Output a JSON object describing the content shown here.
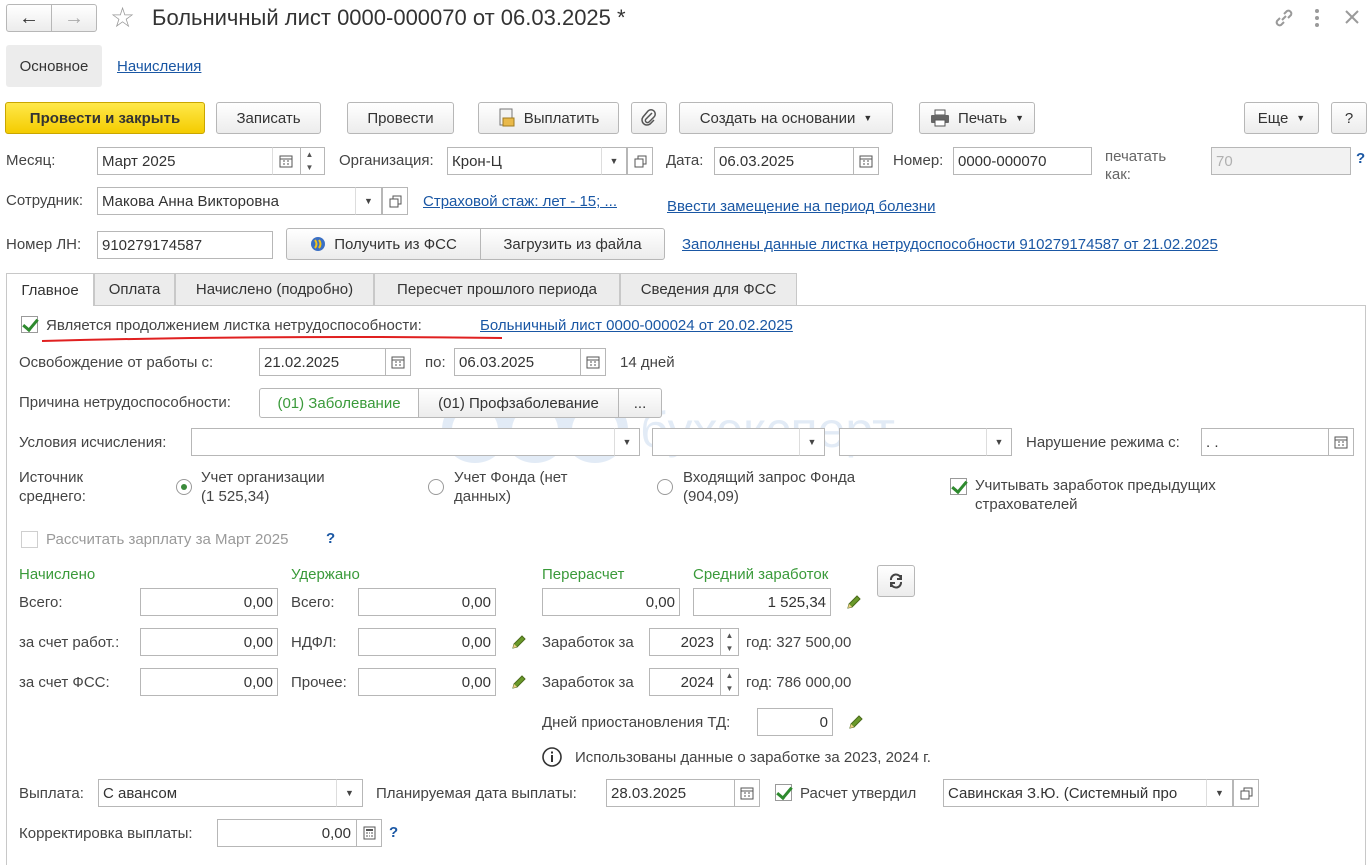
{
  "window": {
    "title": "Больничный лист 0000-000070 от 06.03.2025 *"
  },
  "nav": {
    "back": "←",
    "forward": "→",
    "star": "☆"
  },
  "sections": {
    "main": "Основное",
    "accruals": "Начисления"
  },
  "toolbar": {
    "post_close": "Провести и закрыть",
    "save": "Записать",
    "post": "Провести",
    "pay": "Выплатить",
    "create_based": "Создать на основании",
    "print": "Печать",
    "more": "Еще",
    "help": "?"
  },
  "header": {
    "month_label": "Месяц:",
    "month_value": "Март 2025",
    "org_label": "Организация:",
    "org_value": "Крон-Ц",
    "date_label": "Дата:",
    "date_value": "06.03.2025",
    "number_label": "Номер:",
    "number_value": "0000-000070",
    "print_as_label_1": "печатать",
    "print_as_label_2": "как:",
    "print_as_value": "70",
    "employee_label": "Сотрудник:",
    "employee_value": "Макова Анна Викторовна",
    "insurance_link": "Страховой стаж: лет - 15; ...",
    "replace_link": "Ввести замещение на период болезни",
    "ln_label": "Номер ЛН:",
    "ln_value": "910279174587",
    "get_fss": "Получить из ФСС",
    "load_file": "Загрузить из файла",
    "filled_link": "Заполнены данные листка нетрудоспособности 910279174587 от 21.02.2025"
  },
  "tabs": [
    "Главное",
    "Оплата",
    "Начислено (подробно)",
    "Пересчет прошлого периода",
    "Сведения для ФСС"
  ],
  "main": {
    "continuation_label": "Является продолжением листка нетрудоспособности:",
    "continuation_link": "Больничный лист 0000-000024 от 20.02.2025",
    "release_label": "Освобождение от работы с:",
    "release_from": "21.02.2025",
    "to_label": "по:",
    "release_to": "06.03.2025",
    "days": "14 дней",
    "reason_label": "Причина нетрудоспособности:",
    "reason_1": "(01) Заболевание",
    "reason_2": "(01) Профзаболевание",
    "reason_more": "...",
    "calc_conditions_label": "Условия исчисления:",
    "violation_label": "Нарушение режима с:",
    "violation_value": " .  .",
    "source_label_1": "Источник",
    "source_label_2": "среднего:",
    "radio_1_a": "Учет организации",
    "radio_1_b": "(1 525,34)",
    "radio_2_a": "Учет Фонда (нет",
    "radio_2_b": "данных)",
    "radio_3_a": "Входящий запрос Фонда",
    "radio_3_b": "(904,09)",
    "prev_insurers_a": "Учитывать заработок предыдущих",
    "prev_insurers_b": "страхователей",
    "calc_salary": "Рассчитать зарплату за Март 2025",
    "accrued_title": "Начислено",
    "withheld_title": "Удержано",
    "recalc_title": "Перерасчет",
    "avg_title": "Средний заработок",
    "total_label": "Всего:",
    "employer_label": "за счет работ.:",
    "fss_label": "за счет ФСС:",
    "ndfl_label": "НДФЛ:",
    "other_label": "Прочее:",
    "accrued_total": "0,00",
    "accrued_employer": "0,00",
    "accrued_fss": "0,00",
    "withheld_total": "0,00",
    "withheld_ndfl": "0,00",
    "withheld_other": "0,00",
    "recalc_value": "0,00",
    "avg_value": "1 525,34",
    "earn_for_label": "Заработок за",
    "year_1": "2023",
    "year_1_amount": "год: 327 500,00",
    "year_2": "2024",
    "year_2_amount": "год: 786 000,00",
    "suspension_label": "Дней приостановления ТД:",
    "suspension_value": "0",
    "info_text": "Использованы данные о заработке за  2023,  2024 г.",
    "payout_label": "Выплата:",
    "payout_value": "С авансом",
    "planned_date_label": "Планируемая дата выплаты:",
    "planned_date_value": "28.03.2025",
    "approved_label": "Расчет утвердил",
    "approved_value": "Савинская З.Ю. (Системный про",
    "correction_label": "Корректировка выплаты:",
    "correction_value": "0,00"
  },
  "watermark": "бухэксперт",
  "colors": {
    "accent_yellow": "#f4cc00",
    "link": "#1a57a4",
    "green": "#3a9a3a",
    "underline_red": "#e02020"
  }
}
